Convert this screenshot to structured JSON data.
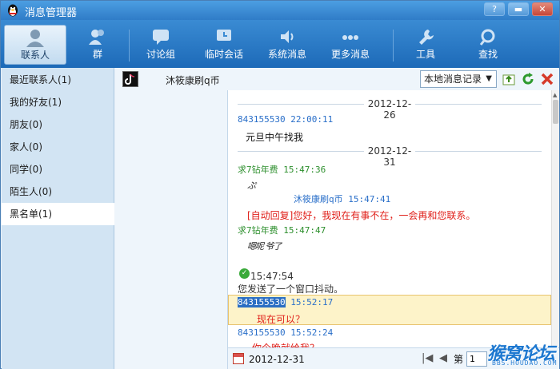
{
  "window": {
    "title": "消息管理器"
  },
  "toolbar": {
    "items": [
      {
        "label": "联系人",
        "icon": "person-icon"
      },
      {
        "label": "群",
        "icon": "group-icon"
      },
      {
        "label": "讨论组",
        "icon": "discussion-icon"
      },
      {
        "label": "临时会话",
        "icon": "temp-chat-icon"
      },
      {
        "label": "系统消息",
        "icon": "speaker-icon"
      },
      {
        "label": "更多消息",
        "icon": "more-icon"
      },
      {
        "label": "工具",
        "icon": "wrench-icon"
      },
      {
        "label": "查找",
        "icon": "search-icon"
      }
    ]
  },
  "sidebar": {
    "items": [
      {
        "label": "最近联系人(1)"
      },
      {
        "label": "我的好友(1)"
      },
      {
        "label": "朋友(0)"
      },
      {
        "label": "家人(0)"
      },
      {
        "label": "同学(0)"
      },
      {
        "label": "陌生人(0)"
      },
      {
        "label": "黑名单(1)"
      }
    ]
  },
  "contact": {
    "name": "沐筱康刷q币"
  },
  "record_select": {
    "value": "本地消息记录"
  },
  "messages": {
    "date1": "2012-12-26",
    "m1_head": "843155530 22:00:11",
    "m1_text": "元旦中午找我",
    "date2": "2012-12-31",
    "m2_head": "求7钻年费 15:47:36",
    "m2_text": "ぷ",
    "m3_head": "沐筱康刷q币 15:47:41",
    "m3_text": "[自动回复]您好，我现在有事不在，一会再和您联系。",
    "m4_head": "求7钻年费 15:47:47",
    "m4_text": "嗯呢 爷了",
    "m5_time": "15:47:54",
    "m5_text": "您发送了一个窗口抖动。",
    "m6_id": "843155530",
    "m6_time": "15:52:17",
    "m6_text": "现在可以？",
    "m7_head": "843155530 15:52:24",
    "m7_text": "你今晚就给我？"
  },
  "bottom": {
    "date": "2012-12-31",
    "page_label": "第",
    "page_value": "1"
  },
  "watermark": {
    "line1": "猴窝论坛",
    "line2": "BBS.HOUDAO.COM"
  },
  "colors": {
    "accent": "#2f7cc7",
    "highlight": "#fdf3c9",
    "link_blue": "#2a6fc9",
    "green": "#2d8f2d",
    "red": "#e0201a"
  }
}
